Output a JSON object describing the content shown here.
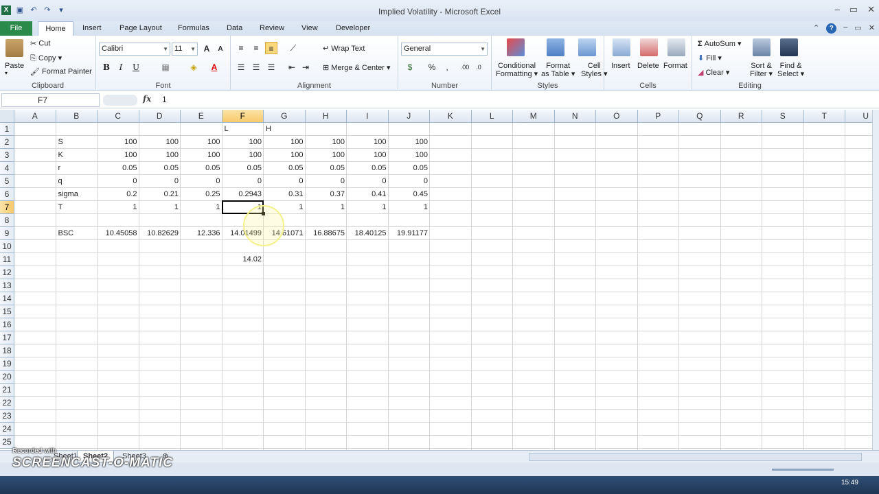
{
  "window": {
    "title": "Implied Volatility - Microsoft Excel"
  },
  "tabs": [
    "File",
    "Home",
    "Insert",
    "Page Layout",
    "Formulas",
    "Data",
    "Review",
    "View",
    "Developer"
  ],
  "ribbon": {
    "groups": [
      "Clipboard",
      "Font",
      "Alignment",
      "Number",
      "Styles",
      "Cells",
      "Editing"
    ],
    "clipboard": {
      "paste": "Paste",
      "cut": "Cut",
      "copy": "Copy",
      "format_painter": "Format Painter"
    },
    "font": {
      "name": "Calibri",
      "size": "11"
    },
    "alignment": {
      "wrap_text": "Wrap Text",
      "merge_center": "Merge & Center"
    },
    "number": {
      "format": "General"
    },
    "styles": {
      "conditional_1": "Conditional",
      "conditional_2": "Formatting",
      "format_1": "Format",
      "format_2": "as Table",
      "cell_1": "Cell",
      "cell_2": "Styles"
    },
    "cells": {
      "insert": "Insert",
      "delete": "Delete",
      "format": "Format"
    },
    "editing": {
      "autosum": "AutoSum",
      "fill": "Fill",
      "clear": "Clear",
      "sort_1": "Sort &",
      "sort_2": "Filter",
      "find_1": "Find &",
      "find_2": "Select"
    }
  },
  "formula_bar": {
    "name_box": "F7",
    "value": "1"
  },
  "sheet": {
    "columns": [
      "A",
      "B",
      "C",
      "D",
      "E",
      "F",
      "G",
      "H",
      "I",
      "J",
      "K",
      "L",
      "M",
      "N",
      "O",
      "P",
      "Q",
      "R",
      "S",
      "T",
      "U"
    ],
    "rows": [
      "1",
      "2",
      "3",
      "4",
      "5",
      "6",
      "7",
      "8",
      "9",
      "10",
      "11",
      "12",
      "13",
      "14",
      "15",
      "16",
      "17",
      "18",
      "19",
      "20",
      "21",
      "22",
      "23",
      "24",
      "25"
    ],
    "selected_cell": "F7",
    "cells": [
      {
        "ref": "F1",
        "value": "L",
        "align": "left"
      },
      {
        "ref": "G1",
        "value": "H",
        "align": "left"
      },
      {
        "ref": "B2",
        "value": "S",
        "align": "left"
      },
      {
        "ref": "C2",
        "value": "100"
      },
      {
        "ref": "D2",
        "value": "100"
      },
      {
        "ref": "E2",
        "value": "100"
      },
      {
        "ref": "F2",
        "value": "100"
      },
      {
        "ref": "G2",
        "value": "100"
      },
      {
        "ref": "H2",
        "value": "100"
      },
      {
        "ref": "I2",
        "value": "100"
      },
      {
        "ref": "J2",
        "value": "100"
      },
      {
        "ref": "B3",
        "value": "K",
        "align": "left"
      },
      {
        "ref": "C3",
        "value": "100"
      },
      {
        "ref": "D3",
        "value": "100"
      },
      {
        "ref": "E3",
        "value": "100"
      },
      {
        "ref": "F3",
        "value": "100"
      },
      {
        "ref": "G3",
        "value": "100"
      },
      {
        "ref": "H3",
        "value": "100"
      },
      {
        "ref": "I3",
        "value": "100"
      },
      {
        "ref": "J3",
        "value": "100"
      },
      {
        "ref": "B4",
        "value": "r",
        "align": "left"
      },
      {
        "ref": "C4",
        "value": "0.05"
      },
      {
        "ref": "D4",
        "value": "0.05"
      },
      {
        "ref": "E4",
        "value": "0.05"
      },
      {
        "ref": "F4",
        "value": "0.05"
      },
      {
        "ref": "G4",
        "value": "0.05"
      },
      {
        "ref": "H4",
        "value": "0.05"
      },
      {
        "ref": "I4",
        "value": "0.05"
      },
      {
        "ref": "J4",
        "value": "0.05"
      },
      {
        "ref": "B5",
        "value": "q",
        "align": "left"
      },
      {
        "ref": "C5",
        "value": "0"
      },
      {
        "ref": "D5",
        "value": "0"
      },
      {
        "ref": "E5",
        "value": "0"
      },
      {
        "ref": "F5",
        "value": "0"
      },
      {
        "ref": "G5",
        "value": "0"
      },
      {
        "ref": "H5",
        "value": "0"
      },
      {
        "ref": "I5",
        "value": "0"
      },
      {
        "ref": "J5",
        "value": "0"
      },
      {
        "ref": "B6",
        "value": "sigma",
        "align": "left"
      },
      {
        "ref": "C6",
        "value": "0.2"
      },
      {
        "ref": "D6",
        "value": "0.21"
      },
      {
        "ref": "E6",
        "value": "0.25"
      },
      {
        "ref": "F6",
        "value": "0.2943"
      },
      {
        "ref": "G6",
        "value": "0.31"
      },
      {
        "ref": "H6",
        "value": "0.37"
      },
      {
        "ref": "I6",
        "value": "0.41"
      },
      {
        "ref": "J6",
        "value": "0.45"
      },
      {
        "ref": "B7",
        "value": "T",
        "align": "left"
      },
      {
        "ref": "C7",
        "value": "1"
      },
      {
        "ref": "D7",
        "value": "1"
      },
      {
        "ref": "E7",
        "value": "1"
      },
      {
        "ref": "F7",
        "value": "1"
      },
      {
        "ref": "G7",
        "value": "1"
      },
      {
        "ref": "H7",
        "value": "1"
      },
      {
        "ref": "I7",
        "value": "1"
      },
      {
        "ref": "J7",
        "value": "1"
      },
      {
        "ref": "B9",
        "value": "BSC",
        "align": "left"
      },
      {
        "ref": "C9",
        "value": "10.45058"
      },
      {
        "ref": "D9",
        "value": "10.82629"
      },
      {
        "ref": "E9",
        "value": "12.336"
      },
      {
        "ref": "F9",
        "value": "14.01499"
      },
      {
        "ref": "G9",
        "value": "14.61071"
      },
      {
        "ref": "H9",
        "value": "16.88675"
      },
      {
        "ref": "I9",
        "value": "18.40125"
      },
      {
        "ref": "J9",
        "value": "19.91177"
      },
      {
        "ref": "F11",
        "value": "14.02"
      }
    ]
  },
  "sheets": [
    "Sheet1",
    "Sheet2",
    "Sheet3"
  ],
  "watermark": {
    "caption": "Recorded with",
    "brand": "SCREENCAST-O-MATIC"
  },
  "taskbar": {
    "clock": "15:49"
  }
}
